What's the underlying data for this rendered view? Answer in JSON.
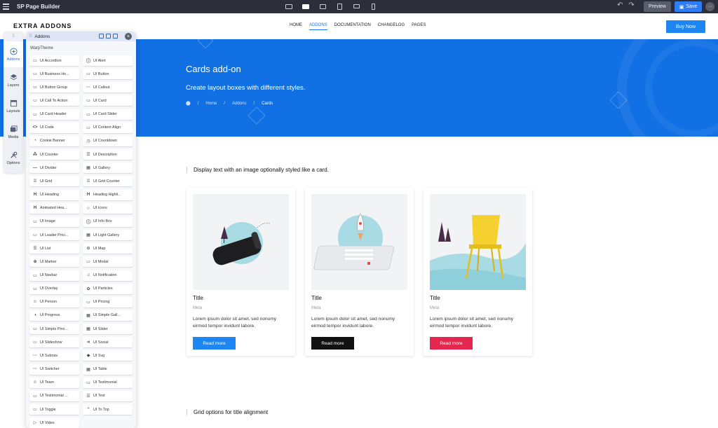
{
  "builder": {
    "title": "SP Page Builder",
    "preview_label": "Preview",
    "save_label": "Save"
  },
  "site": {
    "logo": "EXTRA ADDONS",
    "nav": [
      {
        "label": "HOME"
      },
      {
        "label": "ADDONS"
      },
      {
        "label": "DOCUMENTATION"
      },
      {
        "label": "CHANGELOG"
      },
      {
        "label": "PAGES"
      }
    ],
    "buy_label": "Buy Now"
  },
  "hero": {
    "title": "Cards add-on",
    "subtitle": "Create layout boxes with different styles.",
    "breadcrumb": [
      "Home",
      "Addons",
      "Cards"
    ]
  },
  "content": {
    "section1": "Display text with an image optionally styled like a card.",
    "section2": "Grid options for title alignment",
    "cards": [
      {
        "title": "Title",
        "meta": "Meta",
        "text": "Lorem ipsum dolor sit amet, sed nonumy eirmod tempor invidunt labore.",
        "button": "Read more",
        "color": "#1e86f3"
      },
      {
        "title": "Title",
        "meta": "Meta",
        "text": "Lorem ipsum dolor sit amet, sed nonumy eirmod tempor invidunt labore.",
        "button": "Read more",
        "color": "#111111"
      },
      {
        "title": "Title",
        "meta": "Meta",
        "text": "Lorem ipsum dolor sit amet, sed nonumy eirmod tempor invidunt labore.",
        "button": "Read more",
        "color": "#e5264f"
      }
    ]
  },
  "sidebar": {
    "items": [
      {
        "label": "Addons",
        "icon": "plus-circle-icon"
      },
      {
        "label": "Layers",
        "icon": "layers-icon"
      },
      {
        "label": "Layouts",
        "icon": "layout-icon"
      },
      {
        "label": "Media",
        "icon": "media-icon"
      },
      {
        "label": "Options",
        "icon": "wrench-icon"
      }
    ]
  },
  "panel": {
    "title": "Addons",
    "group": "WarpTheme",
    "addons": [
      {
        "label": "UI Accordion",
        "glyph": "▭"
      },
      {
        "label": "UI Alert",
        "glyph": "ⓘ"
      },
      {
        "label": "UI Business Ho...",
        "glyph": "▭"
      },
      {
        "label": "UI Button",
        "glyph": "▭"
      },
      {
        "label": "UI Button Group",
        "glyph": "▭"
      },
      {
        "label": "UI Callout",
        "glyph": "···"
      },
      {
        "label": "UI Call To Action",
        "glyph": "▭"
      },
      {
        "label": "UI Card",
        "glyph": "▭"
      },
      {
        "label": "UI Card Header",
        "glyph": "▭"
      },
      {
        "label": "UI Card Slider",
        "glyph": "▭"
      },
      {
        "label": "UI Code",
        "glyph": "<>"
      },
      {
        "label": "UI Content Align",
        "glyph": "▭"
      },
      {
        "label": "Cookie Banner",
        "glyph": "◔"
      },
      {
        "label": "UI Countdown",
        "glyph": "◷"
      },
      {
        "label": "UI Counter",
        "glyph": "⁂"
      },
      {
        "label": "UI Description",
        "glyph": "☰"
      },
      {
        "label": "UI Divider",
        "glyph": "—"
      },
      {
        "label": "UI Gallery",
        "glyph": "▦"
      },
      {
        "label": "UI Grid",
        "glyph": "⁞⁞"
      },
      {
        "label": "UI Grid Counter",
        "glyph": "⁞⁞"
      },
      {
        "label": "UI Heading",
        "glyph": "H"
      },
      {
        "label": "Heading Highli...",
        "glyph": "H"
      },
      {
        "label": "Animated Hea...",
        "glyph": "H"
      },
      {
        "label": "UI Icons",
        "glyph": "☆"
      },
      {
        "label": "UI Image",
        "glyph": "▭"
      },
      {
        "label": "UI Info Box",
        "glyph": "ⓘ"
      },
      {
        "label": "UI Leader Prici...",
        "glyph": "▭"
      },
      {
        "label": "UI Light Gallery",
        "glyph": "▦"
      },
      {
        "label": "UI List",
        "glyph": "☰"
      },
      {
        "label": "UI Map",
        "glyph": "⊙"
      },
      {
        "label": "UI Marker",
        "glyph": "⊕"
      },
      {
        "label": "UI Modal",
        "glyph": "▭"
      },
      {
        "label": "UI Navbar",
        "glyph": "▭"
      },
      {
        "label": "UI Notification",
        "glyph": "♫"
      },
      {
        "label": "UI Overlay",
        "glyph": "▭"
      },
      {
        "label": "UI Particles",
        "glyph": "✿"
      },
      {
        "label": "UI Person",
        "glyph": "☺"
      },
      {
        "label": "UI Pricing",
        "glyph": "▭"
      },
      {
        "label": "UI Progress",
        "glyph": "◑"
      },
      {
        "label": "UI Simple Gall...",
        "glyph": "▦"
      },
      {
        "label": "UI Simple Prici...",
        "glyph": "▭"
      },
      {
        "label": "UI Slider",
        "glyph": "▦"
      },
      {
        "label": "UI Slideshow",
        "glyph": "▭"
      },
      {
        "label": "UI Social",
        "glyph": "⋖"
      },
      {
        "label": "UI Subnav",
        "glyph": "···"
      },
      {
        "label": "UI Svg",
        "glyph": "◆"
      },
      {
        "label": "UI Switcher",
        "glyph": "···"
      },
      {
        "label": "UI Table",
        "glyph": "▦"
      },
      {
        "label": "UI Team",
        "glyph": "☺"
      },
      {
        "label": "UI Testimonial",
        "glyph": "▭"
      },
      {
        "label": "UI Testimonial ...",
        "glyph": "▭"
      },
      {
        "label": "UI Text",
        "glyph": "☰"
      },
      {
        "label": "UI Toggle",
        "glyph": "▭"
      },
      {
        "label": "UI To Top",
        "glyph": "⌃"
      },
      {
        "label": "UI Video",
        "glyph": "▷"
      }
    ]
  }
}
